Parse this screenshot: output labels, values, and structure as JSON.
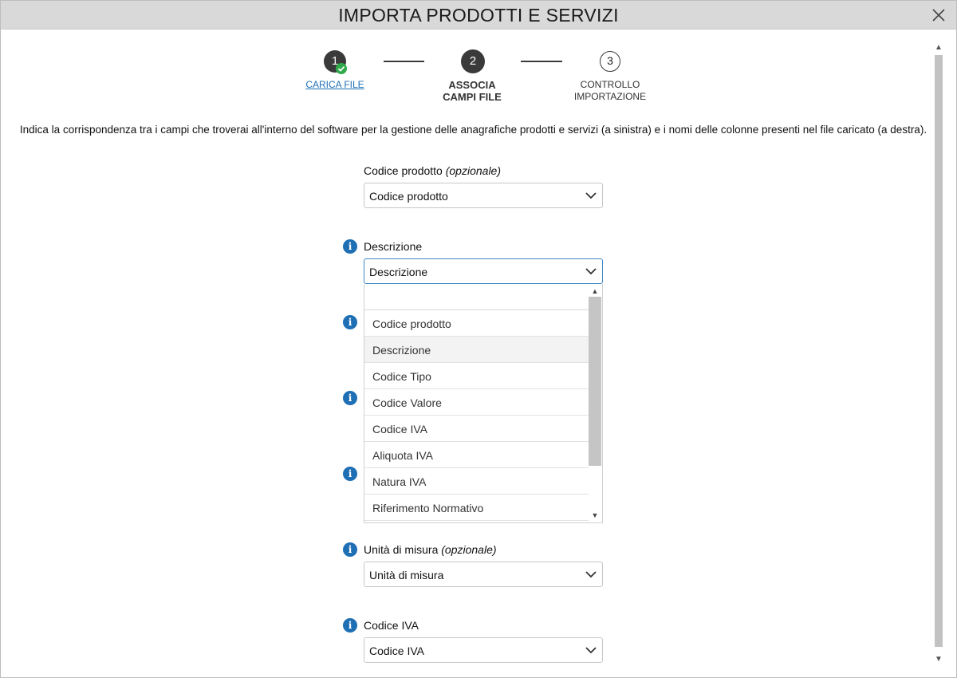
{
  "dialog": {
    "title": "IMPORTA PRODOTTI E SERVIZI",
    "close_icon": "close-icon"
  },
  "stepper": {
    "steps": [
      {
        "number": "1",
        "label": "CARICA FILE",
        "state": "completed"
      },
      {
        "number": "2",
        "label": "ASSOCIA\nCAMPI FILE",
        "state": "active"
      },
      {
        "number": "3",
        "label": "CONTROLLO\nIMPORTAZIONE",
        "state": "pending"
      }
    ]
  },
  "intro_text": "Indica la corrispondenza tra i campi che troverai all'interno del software per la gestione delle anagrafiche prodotti e servizi (a sinistra) e i nomi delle colonne presenti nel file caricato (a destra).",
  "fields": [
    {
      "label": "Codice prodotto",
      "optional": "(opzionale)",
      "value": "Codice prodotto",
      "info": false
    },
    {
      "label": "Descrizione",
      "optional": "",
      "value": "Descrizione",
      "info": true
    },
    {
      "label": "Unità di misura",
      "optional": "(opzionale)",
      "value": "Unità di misura",
      "info": true
    },
    {
      "label": "Codice IVA",
      "optional": "",
      "value": "Codice IVA",
      "info": true
    }
  ],
  "dropdown": {
    "search_value": "",
    "items": [
      "Codice prodotto",
      "Descrizione",
      "Codice Tipo",
      "Codice Valore",
      "Codice IVA",
      "Aliquota IVA",
      "Natura IVA",
      "Riferimento Normativo"
    ],
    "highlighted": "Descrizione"
  },
  "info_icon": "i",
  "colors": {
    "accent": "#1f6fb5",
    "step_dark": "#3a3a3a",
    "success": "#2eaa4a",
    "titlebar": "#d9d9d9"
  }
}
